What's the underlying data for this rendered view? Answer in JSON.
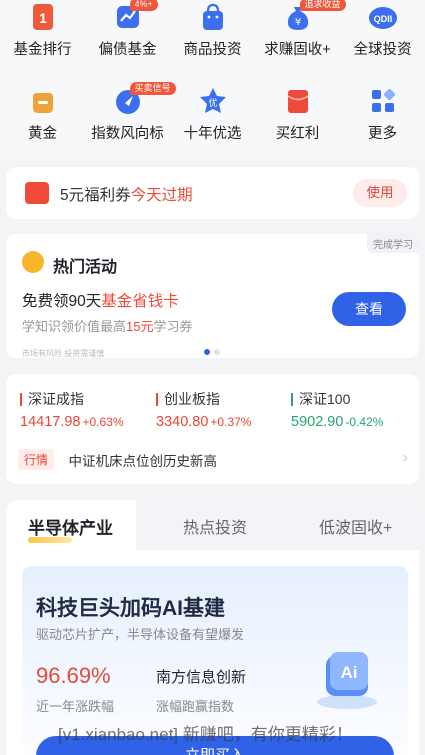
{
  "grid": {
    "row1": [
      {
        "label": "基金排行",
        "icon": "ranking-icon"
      },
      {
        "label": "偏债基金",
        "icon": "trend-chart-icon",
        "badge": "4%+"
      },
      {
        "label": "商品投资",
        "icon": "shopping-bag-icon"
      },
      {
        "label": "求赚固收+",
        "icon": "money-bag-icon",
        "badge": "追求收益"
      },
      {
        "label": "全球投资",
        "icon": "qdii-icon",
        "icon_text": "QDII"
      }
    ],
    "row2": [
      {
        "label": "黄金",
        "icon": "gold-bar-icon"
      },
      {
        "label": "指数风向标",
        "icon": "compass-icon",
        "badge": "买卖信号"
      },
      {
        "label": "十年优选",
        "icon": "star-badge-icon",
        "icon_text": "优"
      },
      {
        "label": "买红利",
        "icon": "red-envelope-icon"
      },
      {
        "label": "更多",
        "icon": "more-grid-icon"
      }
    ]
  },
  "coupon": {
    "text": "5元福利券",
    "highlight": "今天过期",
    "button": "使用"
  },
  "hot": {
    "corner": "完成学习",
    "title": "热门活动",
    "main_prefix": "免费领90天",
    "main_highlight": "基金省钱卡",
    "sub_prefix": "学知识领价值最高",
    "sub_highlight": "15元",
    "sub_suffix": "学习券",
    "button": "查看",
    "risk": "市场有风险 投资需谨慎"
  },
  "market": {
    "indices": [
      {
        "name": "深证成指",
        "value": "14417.98",
        "change": "+0.63%",
        "trend": "up"
      },
      {
        "name": "创业板指",
        "value": "3340.80",
        "change": "+0.37%",
        "trend": "up"
      },
      {
        "name": "深证100",
        "value": "5902.90",
        "change": "-0.42%",
        "trend": "down"
      }
    ],
    "news_tag": "行情",
    "news_text": "中证机床点位创历史新高"
  },
  "sector": {
    "tabs": [
      "半导体产业",
      "热点投资",
      "低波固收+"
    ],
    "card": {
      "title": "科技巨头加码AI基建",
      "subtitle": "驱动芯片扩产，半导体设备有望爆发",
      "rate": "96.69%",
      "rate_label": "近一年涨跌幅",
      "fund_name": "南方信息创新",
      "fund_label": "涨幅跑赢指数",
      "ai_text": "Ai",
      "cta": "立即买入"
    }
  },
  "watermark": "[v1.xianbao.net] 新赚吧，有你更精彩！",
  "colors": {
    "accent": "#2f62e6",
    "red": "#e8473a",
    "green": "#27a56f",
    "gold": "#f7b52c"
  }
}
